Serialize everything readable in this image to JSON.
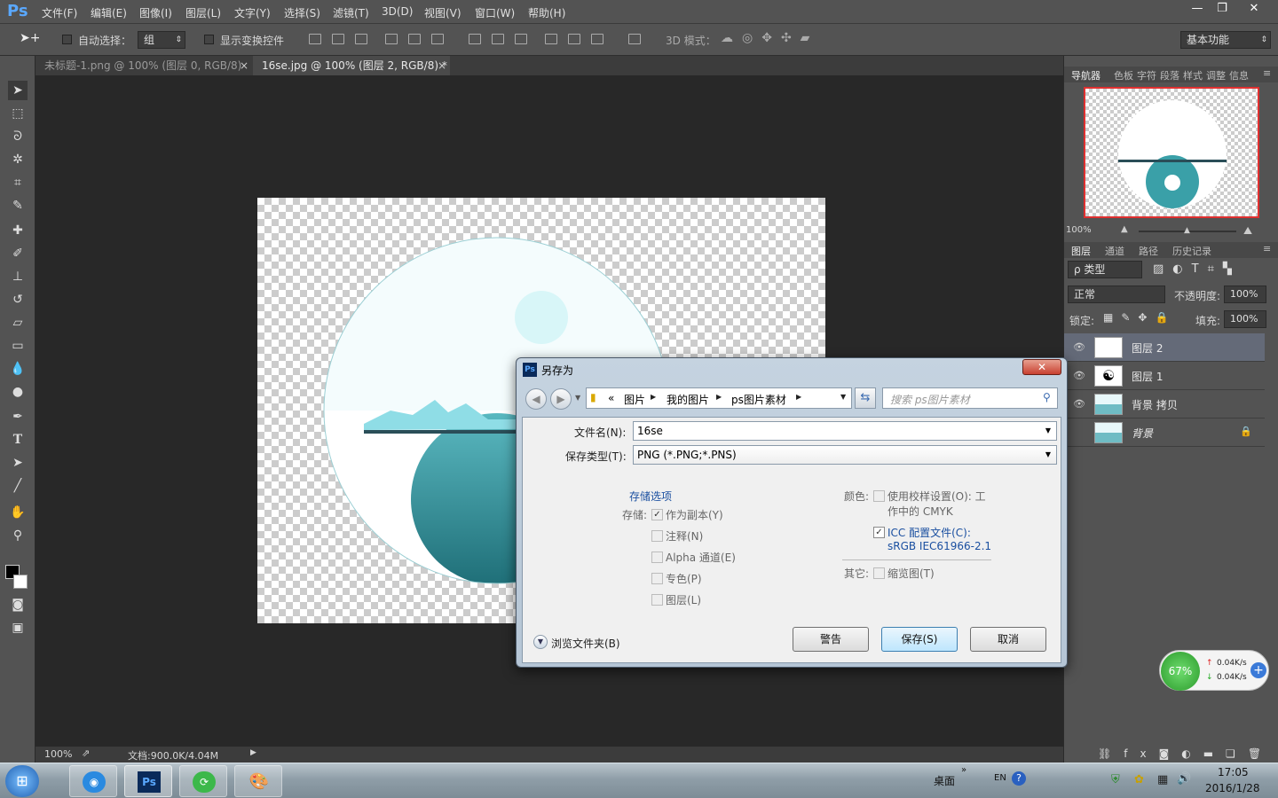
{
  "app": {
    "logo": "Ps",
    "menus": [
      "文件(F)",
      "编辑(E)",
      "图像(I)",
      "图层(L)",
      "文字(Y)",
      "选择(S)",
      "滤镜(T)",
      "3D(D)",
      "视图(V)",
      "窗口(W)",
      "帮助(H)"
    ],
    "window_buttons": [
      "—",
      "❐",
      "✕"
    ]
  },
  "options": {
    "auto_select_label": "自动选择：",
    "auto_select_value": "组",
    "show_transform_label": "显示变换控件",
    "mode_3d_label": "3D 模式：",
    "workspace": "基本功能"
  },
  "tabs": [
    {
      "label": "未标题-1.png @ 100% (图层 0, RGB/8)",
      "close": "×"
    },
    {
      "label": "16se.jpg @ 100% (图层 2, RGB/8) *",
      "close": "×"
    }
  ],
  "status": {
    "zoom": "100%",
    "doc": "文档:900.0K/4.04M"
  },
  "navigator": {
    "tabs": [
      "导航器",
      "色板",
      "字符",
      "段落",
      "样式",
      "调整",
      "信息"
    ],
    "zoom": "100%"
  },
  "layers_panel": {
    "tabs": [
      "图层",
      "通道",
      "路径",
      "历史记录"
    ],
    "filter": "ρ 类型",
    "blend_mode": "正常",
    "opacity_label": "不透明度:",
    "opacity_value": "100%",
    "lock_label": "锁定:",
    "fill_label": "填充:",
    "fill_value": "100%",
    "layers": [
      {
        "name": "图层 2",
        "selected": true
      },
      {
        "name": "图层 1",
        "selected": false
      },
      {
        "name": "背景 拷贝",
        "selected": false
      },
      {
        "name": "背景",
        "selected": false,
        "locked": true
      }
    ],
    "footer_icons": [
      "link-icon",
      "fx-icon",
      "mask-icon",
      "adjustment-icon",
      "folder-icon",
      "new-layer-icon",
      "trash-icon"
    ]
  },
  "net_widget": {
    "percent": "67%",
    "up": "0.04K/s",
    "down": "0.04K/s"
  },
  "dialog": {
    "title": "另存为",
    "path": [
      "«",
      "图片",
      "我的图片",
      "ps图片素材"
    ],
    "search_placeholder": "搜索 ps图片素材",
    "filename_label": "文件名(N):",
    "filename_value": "16se",
    "filetype_label": "保存类型(T):",
    "filetype_value": "PNG (*.PNG;*.PNS)",
    "save_options_title": "存储选项",
    "save_label": "存储:",
    "opt_copy": "作为副本(Y)",
    "opt_notes": "注释(N)",
    "opt_alpha": "Alpha 通道(E)",
    "opt_spot": "专色(P)",
    "opt_layers": "图层(L)",
    "color_label": "颜色:",
    "opt_proof": "使用校样设置(O): 工",
    "opt_proof2": "作中的 CMYK",
    "opt_icc": "ICC 配置文件(C):",
    "opt_icc2": "sRGB IEC61966-2.1",
    "other_label": "其它:",
    "opt_thumb": "缩览图(T)",
    "browse": "浏览文件夹(B)",
    "btn_warn": "警告",
    "btn_save": "保存(S)",
    "btn_cancel": "取消"
  },
  "taskbar": {
    "desktop": "桌面",
    "lang": "EN",
    "time": "17:05",
    "date": "2016/1/28"
  }
}
